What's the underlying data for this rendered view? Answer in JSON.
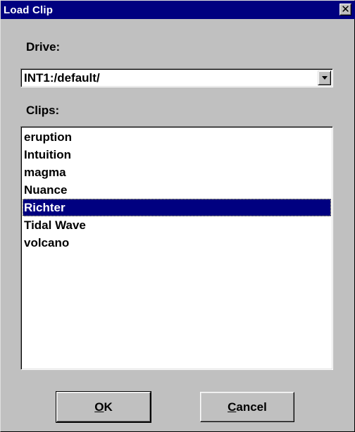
{
  "window": {
    "title": "Load Clip",
    "close_glyph": "✕"
  },
  "drive": {
    "label": "Drive:",
    "selected": "INT1:/default/"
  },
  "clips": {
    "label": "Clips:",
    "items": [
      "eruption",
      "Intuition",
      "magma",
      "Nuance",
      "Richter",
      "Tidal Wave",
      "volcano"
    ],
    "selected_index": 4
  },
  "buttons": {
    "ok": {
      "mnemonic": "O",
      "rest": "K"
    },
    "cancel": {
      "mnemonic": "C",
      "rest": "ancel"
    }
  },
  "colors": {
    "titlebar": "#000080",
    "selection": "#000080",
    "face": "#c0c0c0"
  }
}
